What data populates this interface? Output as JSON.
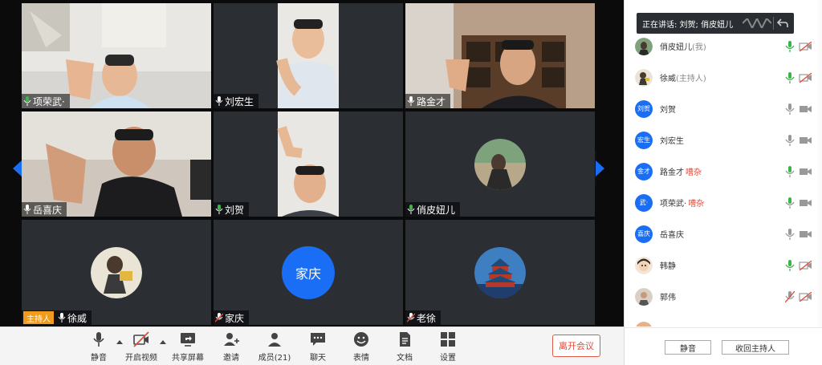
{
  "tiles": [
    {
      "name": "项荣武·",
      "type": "video",
      "mic": "on"
    },
    {
      "name": "刘宏生",
      "type": "video",
      "mic": "on"
    },
    {
      "name": "路金才",
      "type": "video",
      "mic": "on"
    },
    {
      "name": "岳喜庆",
      "type": "video",
      "mic": "on"
    },
    {
      "name": "刘贺",
      "type": "video",
      "mic": "on"
    },
    {
      "name": "俏皮妞儿",
      "type": "avatar-image",
      "mic": "on"
    },
    {
      "name": "徐威",
      "type": "avatar-image",
      "mic": "on",
      "host_label": "主持人"
    },
    {
      "name": "家庆",
      "type": "avatar-text",
      "avatar_text": "家庆",
      "mic": "muted"
    },
    {
      "name": "老徐",
      "type": "avatar-image",
      "mic": "muted"
    }
  ],
  "toolbar": {
    "mute_label": "静音",
    "video_label": "开启视频",
    "share_label": "共享屏幕",
    "invite_label": "邀请",
    "members_label": "成员(21)",
    "chat_label": "聊天",
    "emoji_label": "表情",
    "doc_label": "文档",
    "settings_label": "设置",
    "leave_label": "离开会议"
  },
  "panel": {
    "speaking_text": "正在讲话: 刘贺; 俏皮妞儿",
    "members": [
      {
        "name": "俏皮妞儿",
        "tag": "(我)",
        "avatar": "image",
        "mic": "active-green",
        "cam": "off",
        "noisy": ""
      },
      {
        "name": "徐威",
        "tag": "(主持人)",
        "avatar": "image",
        "mic": "active-green",
        "cam": "off",
        "noisy": ""
      },
      {
        "name": "刘贺",
        "tag": "",
        "avatar": "text",
        "avatar_text": "刘贺",
        "mic": "gray",
        "cam": "on",
        "noisy": ""
      },
      {
        "name": "刘宏生",
        "tag": "",
        "avatar": "text",
        "avatar_text": "宏生",
        "mic": "gray",
        "cam": "on",
        "noisy": ""
      },
      {
        "name": "路金才",
        "tag": "",
        "avatar": "text",
        "avatar_text": "金才",
        "mic": "active-green",
        "cam": "on",
        "noisy": "嘈杂"
      },
      {
        "name": "项荣武·",
        "tag": "",
        "avatar": "text",
        "avatar_text": "武·",
        "mic": "active-green",
        "cam": "on",
        "noisy": "嘈杂"
      },
      {
        "name": "岳喜庆",
        "tag": "",
        "avatar": "text",
        "avatar_text": "喜庆",
        "mic": "gray",
        "cam": "on",
        "noisy": ""
      },
      {
        "name": "韩静",
        "tag": "",
        "avatar": "image",
        "mic": "active-green",
        "cam": "off",
        "noisy": ""
      },
      {
        "name": "郭伟",
        "tag": "",
        "avatar": "image",
        "mic": "muted",
        "cam": "off",
        "noisy": ""
      }
    ],
    "mute_all_label": "静音",
    "reclaim_host_label": "收回主持人"
  },
  "colors": {
    "accent": "#1a6ef5",
    "active_mic": "#3cb44a",
    "danger": "#e04b3a",
    "host_tag": "#f19a1b"
  }
}
